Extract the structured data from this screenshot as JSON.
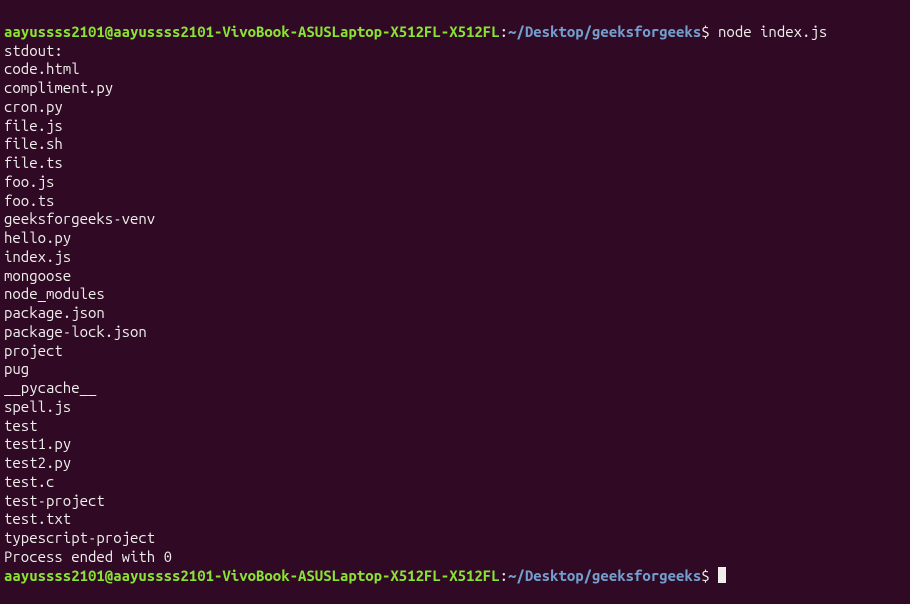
{
  "prompt1": {
    "user_host": "aayussss2101@aayussss2101-VivoBook-ASUSLaptop-X512FL-X512FL",
    "colon": ":",
    "path": "~/Desktop/geeksforgeeks",
    "dollar": "$",
    "command": " node index.js"
  },
  "output": {
    "lines": [
      "stdout:",
      "code.html",
      "compliment.py",
      "cron.py",
      "file.js",
      "file.sh",
      "file.ts",
      "foo.js",
      "foo.ts",
      "geeksforgeeks-venv",
      "hello.py",
      "index.js",
      "mongoose",
      "node_modules",
      "package.json",
      "package-lock.json",
      "project",
      "pug",
      "__pycache__",
      "spell.js",
      "test",
      "test1.py",
      "test2.py",
      "test.c",
      "test-project",
      "test.txt",
      "typescript-project",
      "",
      "Process ended with 0"
    ]
  },
  "prompt2": {
    "user_host": "aayussss2101@aayussss2101-VivoBook-ASUSLaptop-X512FL-X512FL",
    "colon": ":",
    "path": "~/Desktop/geeksforgeeks",
    "dollar": "$",
    "command": " "
  }
}
